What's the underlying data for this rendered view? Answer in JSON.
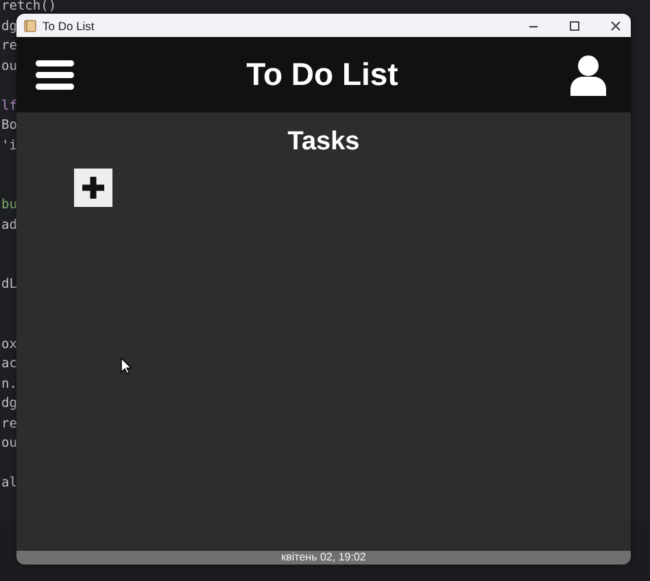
{
  "editor": {
    "lines": [
      {
        "kind": "code",
        "text": "retch()"
      },
      {
        "kind": "code",
        "text": "dg"
      },
      {
        "kind": "code",
        "text": "re"
      },
      {
        "kind": "code",
        "text": "ou"
      },
      {
        "kind": "blank"
      },
      {
        "kind": "keyword",
        "text": "lf"
      },
      {
        "kind": "code",
        "text": "Bo"
      },
      {
        "kind": "code",
        "text": "'i"
      },
      {
        "kind": "blank"
      },
      {
        "kind": "blank"
      },
      {
        "kind": "string",
        "text": "bu"
      },
      {
        "kind": "code",
        "text": "ad"
      },
      {
        "kind": "blank"
      },
      {
        "kind": "blank"
      },
      {
        "kind": "code",
        "text": "dL"
      },
      {
        "kind": "blank"
      },
      {
        "kind": "blank"
      },
      {
        "kind": "code",
        "text": "ox"
      },
      {
        "kind": "code",
        "text": "ac"
      },
      {
        "kind": "code",
        "text": "n."
      },
      {
        "kind": "code",
        "text": "dg"
      },
      {
        "kind": "code",
        "text": "re"
      },
      {
        "kind": "code",
        "text": "ou"
      },
      {
        "kind": "blank"
      },
      {
        "kind": "code",
        "text": "al"
      }
    ]
  },
  "window": {
    "title": "To Do List"
  },
  "header": {
    "title": "To Do List"
  },
  "content": {
    "heading": "Tasks"
  },
  "status_bar": {
    "text": "квітень 02, 19:02"
  }
}
